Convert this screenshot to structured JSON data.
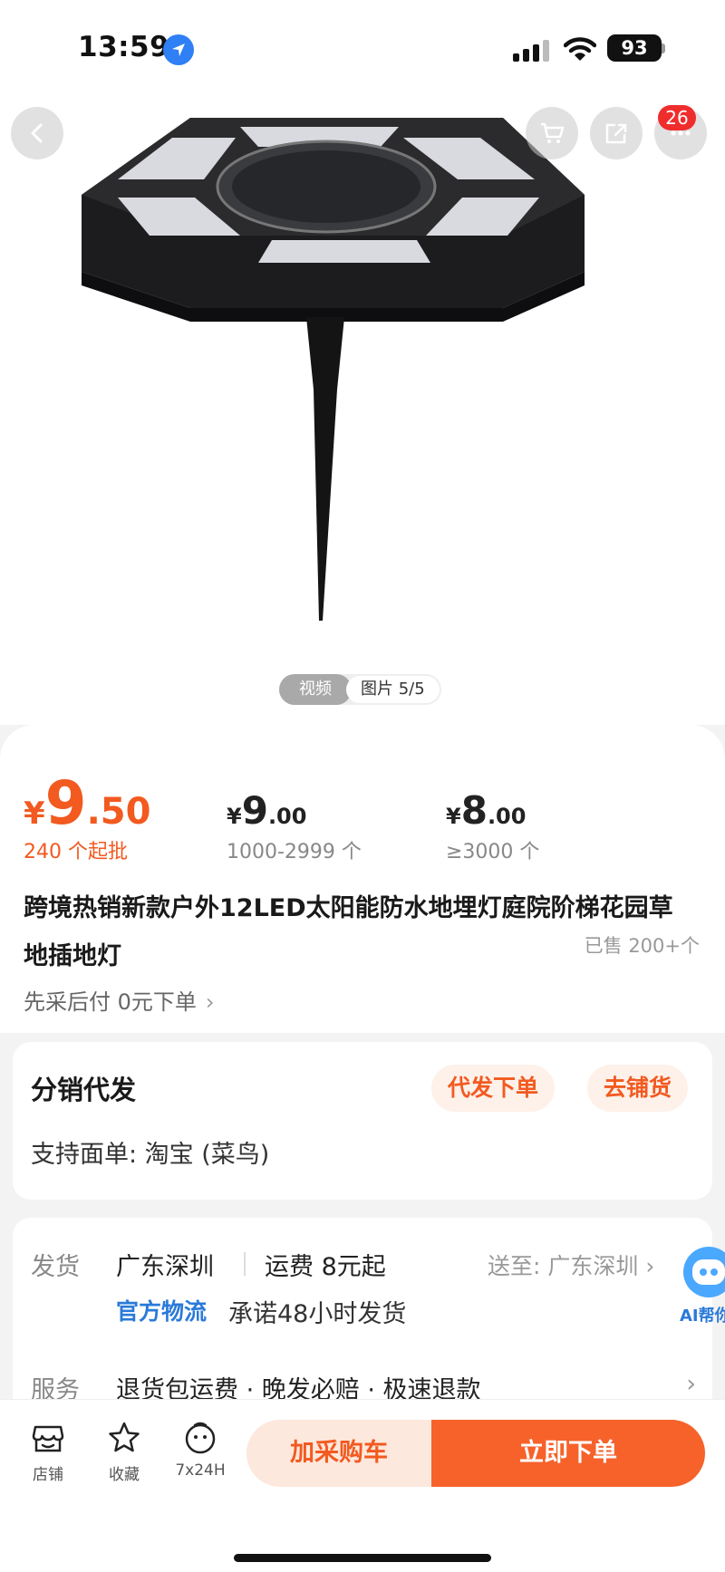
{
  "status_bar": {
    "time": "13:59",
    "battery": "93"
  },
  "gallery": {
    "cart_badge": "26",
    "media_toggle": {
      "video": "视频",
      "photos": "图片 5/5"
    }
  },
  "product": {
    "price": {
      "symbol": "¥",
      "integer": "9",
      "decimal": ".50",
      "note": "240 个起批"
    },
    "tiers": [
      {
        "symbol": "¥",
        "integer": "9",
        "decimal": ".00",
        "range": "1000-2999 个"
      },
      {
        "symbol": "¥",
        "integer": "8",
        "decimal": ".00",
        "range": "≥3000 个"
      }
    ],
    "title": "跨境热销新款户外12LED太阳能防水地埋灯庭院阶梯花园草地插地灯",
    "sold": "已售 200+个",
    "pay_later": "先采后付 0元下单",
    "chevron": "›"
  },
  "distribution": {
    "title": "分销代发",
    "dropship_button": "代发下单",
    "stock_button": "去铺货",
    "support": "支持面单:  淘宝 (菜鸟)"
  },
  "shipping": {
    "label": "发货",
    "origin": "广东深圳",
    "fee": "运费 8元起",
    "ship_to": "送至: 广东深圳 ›",
    "official": "官方物流",
    "promise": "承诺48小时发货",
    "service_label": "服务",
    "service_items": "退货包运费 · 晚发必赔 · 极速退款",
    "chevron": "›"
  },
  "ai_help": {
    "label": "AI帮你"
  },
  "bottom_bar": {
    "tabs": [
      {
        "label": "店铺"
      },
      {
        "label": "收藏"
      },
      {
        "label": "7x24H"
      }
    ],
    "add_cart": "加采购车",
    "buy_now": "立即下单"
  },
  "colors": {
    "accent": "#f25a20",
    "buy_button": "#f6622a",
    "cart_button_bg": "#fde8dd",
    "link_blue": "#2a7ad8"
  }
}
